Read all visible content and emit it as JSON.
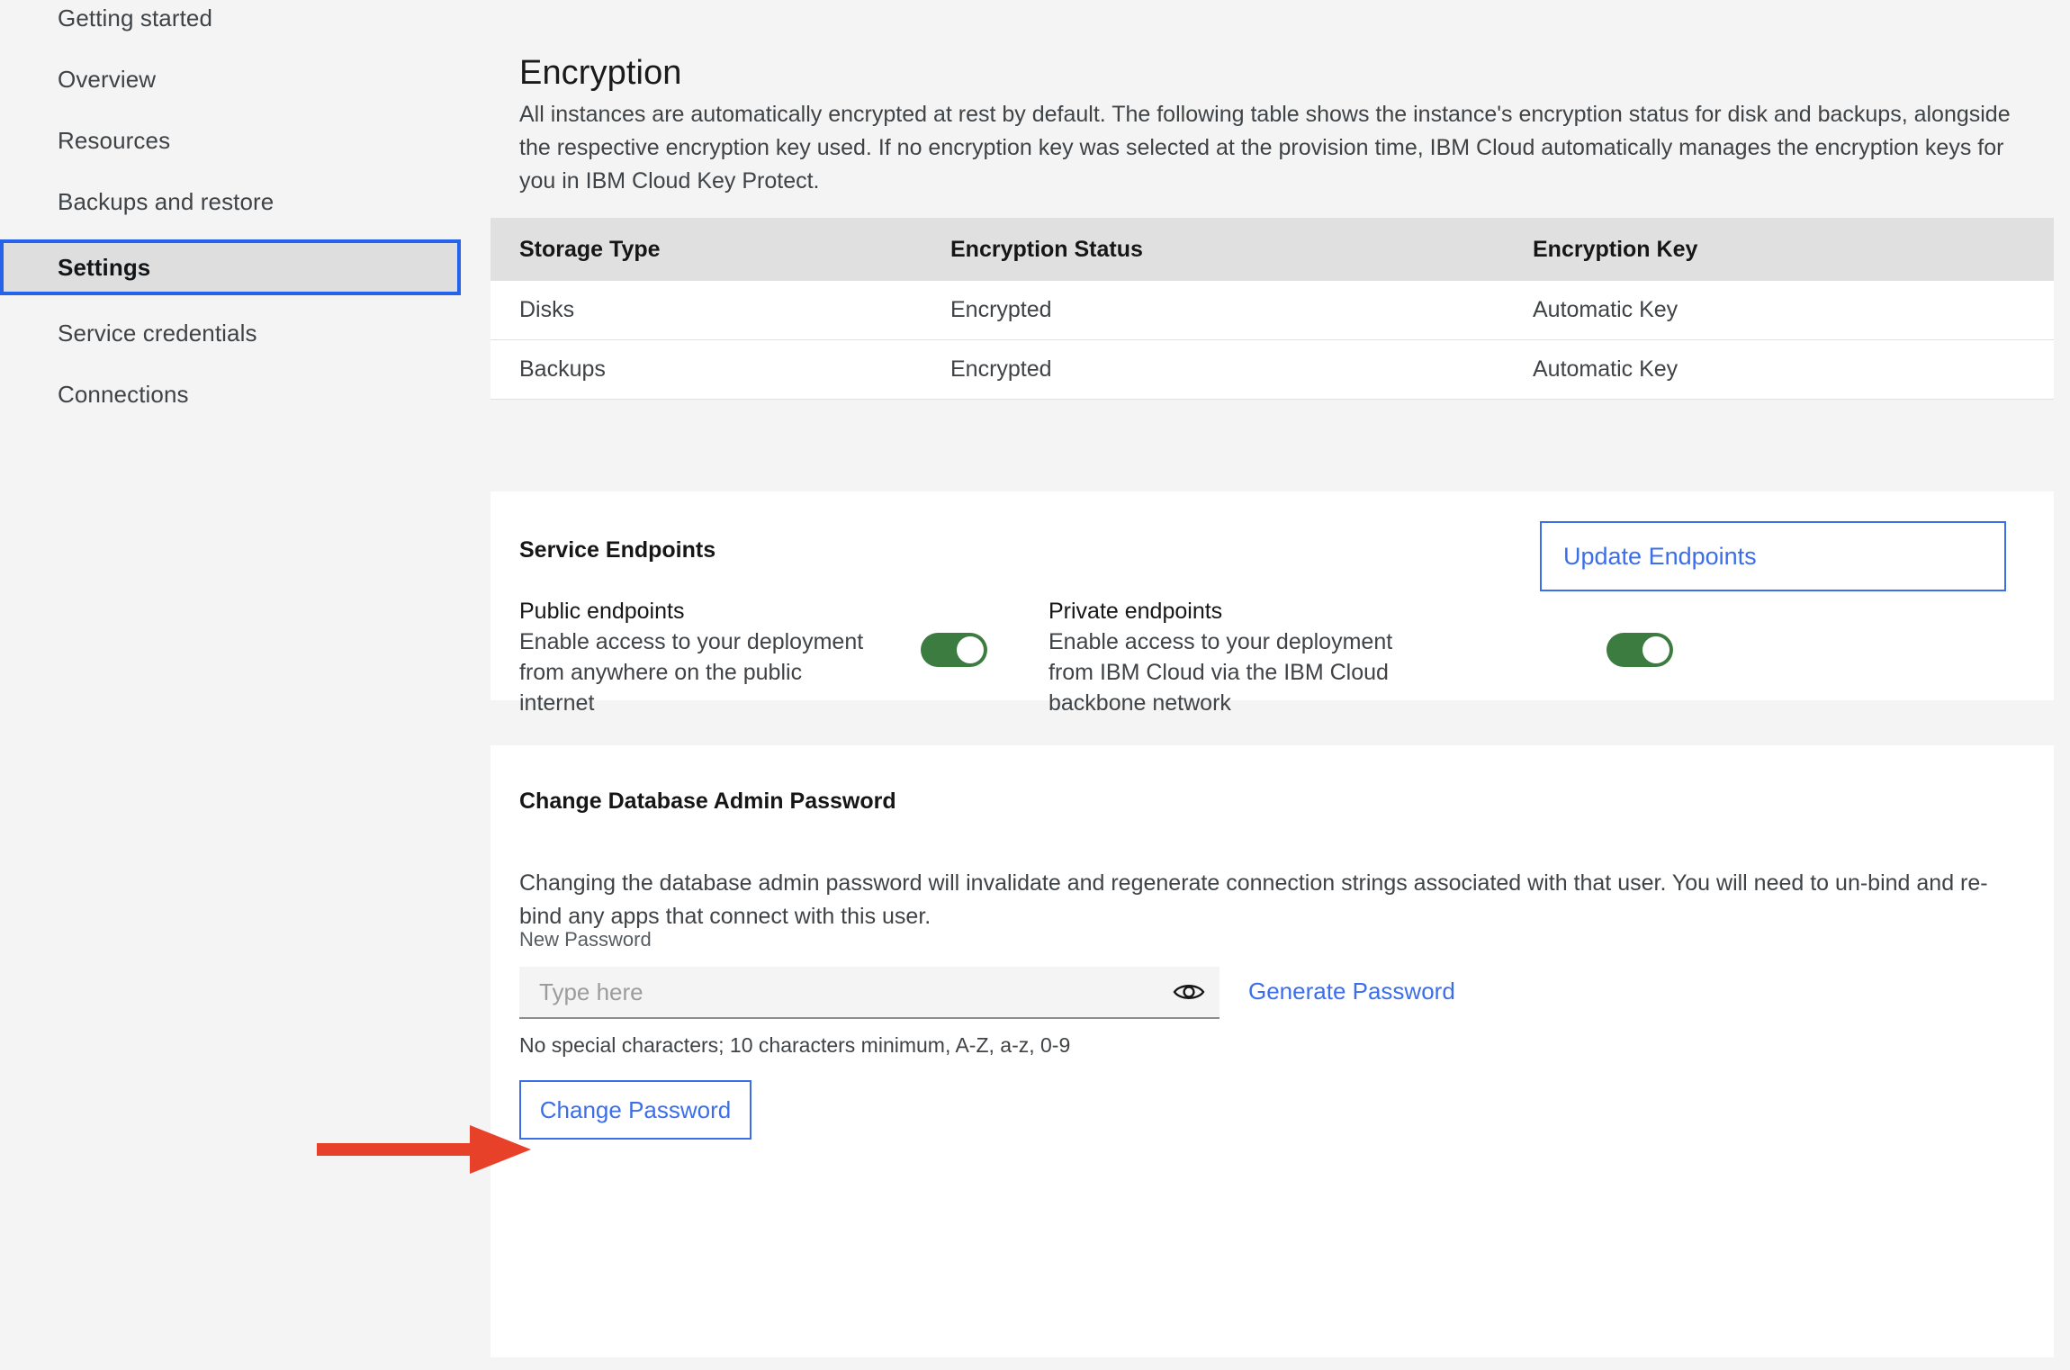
{
  "sidebar": {
    "items": [
      {
        "label": "Getting started",
        "selected": false
      },
      {
        "label": "Overview",
        "selected": false
      },
      {
        "label": "Resources",
        "selected": false
      },
      {
        "label": "Backups and restore",
        "selected": false
      },
      {
        "label": "Settings",
        "selected": true
      },
      {
        "label": "Service credentials",
        "selected": false
      },
      {
        "label": "Connections",
        "selected": false
      }
    ]
  },
  "encryption": {
    "title": "Encryption",
    "description": "All instances are automatically encrypted at rest by default. The following table shows the instance's encryption status for disk and backups, alongside the respective encryption key used. If no encryption key was selected at the provision time, IBM Cloud automatically manages the encryption keys for you in IBM Cloud Key Protect.",
    "table": {
      "columns": [
        "Storage Type",
        "Encryption Status",
        "Encryption Key"
      ],
      "rows": [
        [
          "Disks",
          "Encrypted",
          "Automatic Key"
        ],
        [
          "Backups",
          "Encrypted",
          "Automatic Key"
        ]
      ]
    }
  },
  "service_endpoints": {
    "title": "Service Endpoints",
    "update_button": "Update Endpoints",
    "public": {
      "name": "Public endpoints",
      "description": "Enable access to your deployment from anywhere on the public internet",
      "enabled": "on"
    },
    "private": {
      "name": "Private endpoints",
      "description": "Enable access to your deployment from IBM Cloud via the IBM Cloud backbone network",
      "enabled": "on"
    }
  },
  "change_password": {
    "title": "Change Database Admin Password",
    "description": "Changing the database admin password will invalidate and regenerate connection strings associated with that user. You will need to un-bind and re-bind any apps that connect with this user.",
    "field_label": "New Password",
    "input_value": "",
    "input_placeholder": "Type here",
    "show_password_icon": "eye-icon",
    "generate_link": "Generate Password",
    "help_text": "No special characters; 10 characters minimum, A-Z, a-z, 0-9",
    "submit_button": "Change Password"
  },
  "annotation": {
    "arrow_color": "#e8412a",
    "points_to": "password-input"
  },
  "colors": {
    "accent_blue": "#3b6ee8",
    "toggle_green": "#3d7c40",
    "selection_outline": "#2563eb",
    "page_bg": "#f4f4f4",
    "card_bg": "#ffffff",
    "table_header_bg": "#e0e0e0"
  }
}
